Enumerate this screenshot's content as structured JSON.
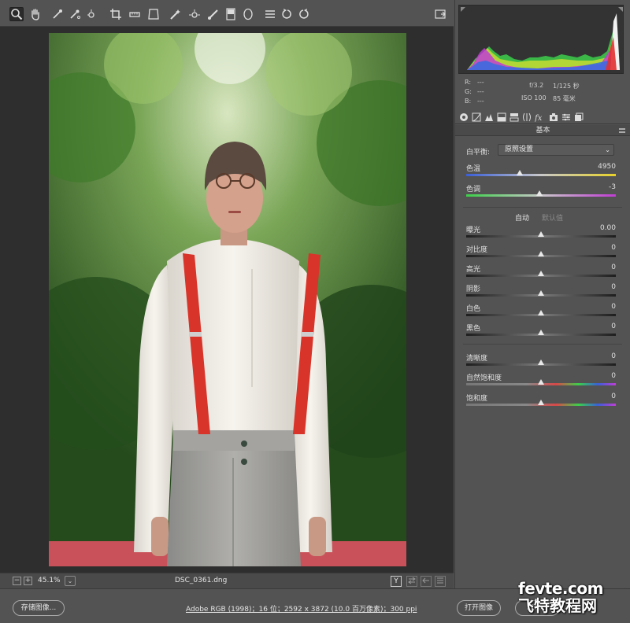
{
  "toolbar": {
    "tools": [
      "zoom-tool",
      "hand-tool",
      "white-balance-tool",
      "color-sampler-tool",
      "targeted-adjustment-tool",
      "crop-tool",
      "straighten-tool",
      "transform-tool",
      "spot-removal-tool",
      "red-eye-tool",
      "adjustment-brush-tool",
      "graduated-filter-tool",
      "radial-filter-tool",
      "preferences-tool",
      "rotate-left-tool",
      "rotate-right-tool"
    ]
  },
  "preview": {
    "zoom_minus": "−",
    "zoom_plus": "+",
    "zoom_level": "45.1%",
    "zoom_dropdown": "⌄",
    "filename": "DSC_0361.dng",
    "view_y": "Y"
  },
  "readout": {
    "r_label": "R:",
    "r_val": "---",
    "g_label": "G:",
    "g_val": "---",
    "b_label": "B:",
    "b_val": "---",
    "aperture": "f/3.2",
    "shutter": "1/125 秒",
    "iso": "ISO 100",
    "focal": "85 毫米"
  },
  "panel": {
    "section_title": "基本",
    "white_balance_label": "白平衡:",
    "white_balance_value": "原照设置",
    "auto_label": "自动",
    "default_label": "默认值"
  },
  "sliders": [
    {
      "label": "色温",
      "value": "4950",
      "pos": 0.36,
      "track": "temp"
    },
    {
      "label": "色调",
      "value": "-3",
      "pos": 0.49,
      "track": "tint"
    },
    {
      "label": "曝光",
      "value": "0.00",
      "pos": 0.5,
      "track": "gray"
    },
    {
      "label": "对比度",
      "value": "0",
      "pos": 0.5,
      "track": "gray"
    },
    {
      "label": "高光",
      "value": "0",
      "pos": 0.5,
      "track": "gray"
    },
    {
      "label": "阴影",
      "value": "0",
      "pos": 0.5,
      "track": "gray"
    },
    {
      "label": "白色",
      "value": "0",
      "pos": 0.5,
      "track": "gray"
    },
    {
      "label": "黑色",
      "value": "0",
      "pos": 0.5,
      "track": "gray"
    },
    {
      "label": "清晰度",
      "value": "0",
      "pos": 0.5,
      "track": "gray"
    },
    {
      "label": "自然饱和度",
      "value": "0",
      "pos": 0.5,
      "track": "vib"
    },
    {
      "label": "饱和度",
      "value": "0",
      "pos": 0.5,
      "track": "sat"
    }
  ],
  "bottombar": {
    "save_label": "存储图像...",
    "workflow_info": "Adobe RGB (1998)；16 位；2592 x 3872 (10.0 百万像素)；300 ppi",
    "open_label": "打开图像",
    "cancel_label": "取消"
  },
  "watermark": {
    "line1": "fevte.com",
    "line2": "飞特教程网"
  },
  "colors": {
    "panel_bg": "#535353",
    "preview_bg": "#2e2e2e",
    "suspender_red": "#d8342a",
    "shirt_white": "#f3f0ea",
    "foliage_green": "#3c6a2b"
  }
}
